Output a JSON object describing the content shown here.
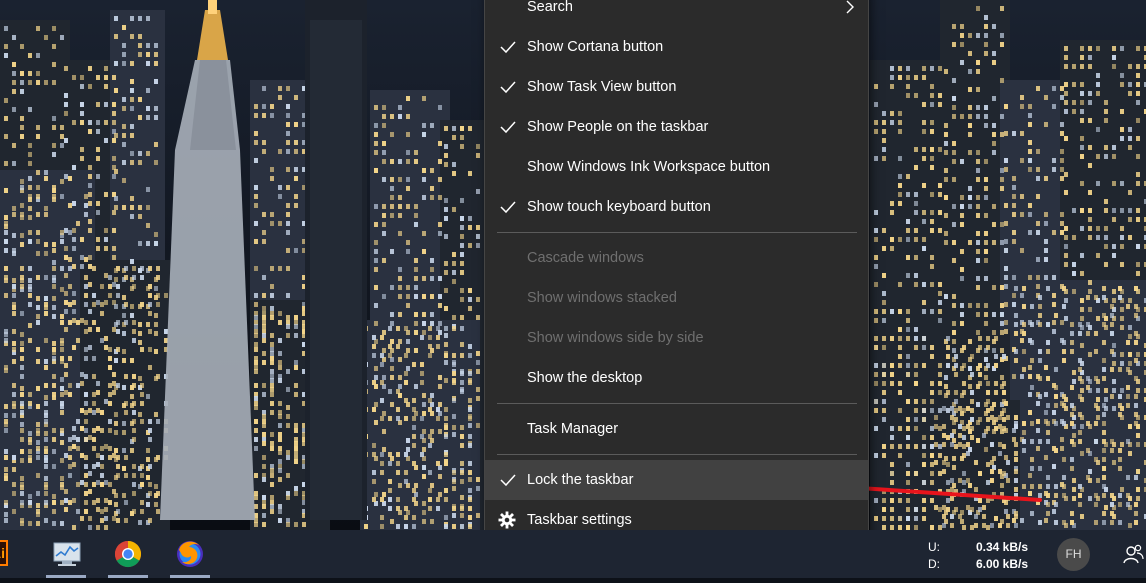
{
  "menu": {
    "items": [
      {
        "label": "Search",
        "checked": false,
        "disabled": false,
        "submenu": true
      },
      {
        "label": "Show Cortana button",
        "checked": true,
        "disabled": false
      },
      {
        "label": "Show Task View button",
        "checked": true,
        "disabled": false
      },
      {
        "label": "Show People on the taskbar",
        "checked": true,
        "disabled": false
      },
      {
        "label": "Show Windows Ink Workspace button",
        "checked": false,
        "disabled": false
      },
      {
        "label": "Show touch keyboard button",
        "checked": true,
        "disabled": false
      },
      {
        "label": "Cascade windows",
        "checked": false,
        "disabled": true
      },
      {
        "label": "Show windows stacked",
        "checked": false,
        "disabled": true
      },
      {
        "label": "Show windows side by side",
        "checked": false,
        "disabled": true
      },
      {
        "label": "Show the desktop",
        "checked": false,
        "disabled": false
      },
      {
        "label": "Task Manager",
        "checked": false,
        "disabled": false
      },
      {
        "label": "Lock the taskbar",
        "checked": true,
        "disabled": false,
        "highlighted": true
      },
      {
        "label": "Taskbar settings",
        "checked": false,
        "disabled": false,
        "icon": "gear-icon"
      }
    ]
  },
  "annotation": {
    "type": "arrow",
    "color": "#e8141c",
    "points_to": "Lock the taskbar"
  },
  "taskbar": {
    "apps": [
      {
        "name": "adobe-illustrator",
        "icon_text": "Ai"
      },
      {
        "name": "performance-monitor",
        "icon": "monitor-chart-icon"
      },
      {
        "name": "google-chrome",
        "icon": "chrome-icon"
      },
      {
        "name": "firefox",
        "icon": "firefox-icon"
      }
    ],
    "network": {
      "upload_label": "U:",
      "upload_value": "0.34 kB/s",
      "download_label": "D:",
      "download_value": "6.00 kB/s"
    },
    "avatar_initials": "FH",
    "people_icon": "people-icon"
  },
  "colors": {
    "menu_bg": "#2b2b2b",
    "menu_hover": "#414141",
    "menu_text": "#ffffff",
    "menu_disabled_text": "#6f6f6f",
    "taskbar_bg": "#1e2532",
    "arrow": "#e8141c"
  }
}
